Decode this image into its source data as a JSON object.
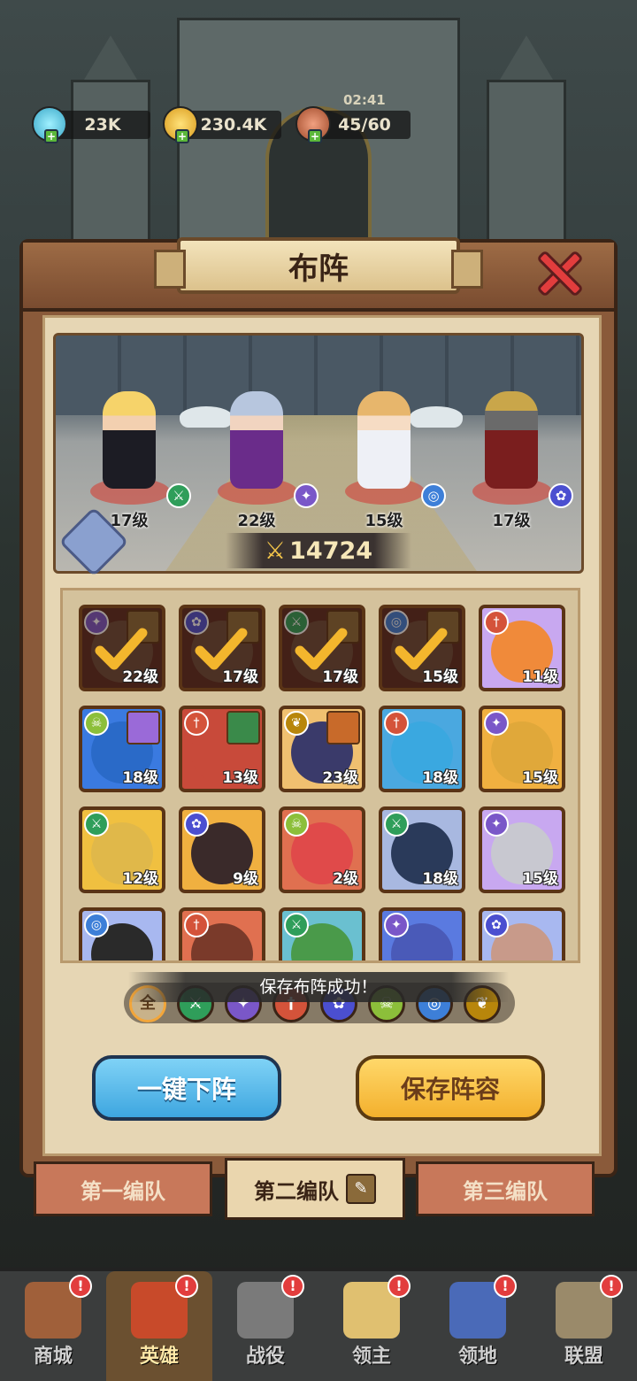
{
  "resources": {
    "gems": "23K",
    "gold": "230.4K",
    "stamina": "45/60",
    "timer": "02:41"
  },
  "panel": {
    "title": "布阵"
  },
  "stage": {
    "heroes": [
      {
        "level": "17级",
        "class_icon": "bow-icon",
        "color": "#2f9e5a"
      },
      {
        "level": "22级",
        "class_icon": "staff-icon",
        "color": "#7a57c8"
      },
      {
        "level": "15级",
        "class_icon": "swirl-icon",
        "color": "#3d7fd8"
      },
      {
        "level": "17级",
        "class_icon": "paw-icon",
        "color": "#4b4fd0"
      }
    ],
    "power": "14724"
  },
  "hero_cards": [
    {
      "level": "22级",
      "selected": true,
      "class_icon": "staff-icon",
      "class_color": "#7a57c8"
    },
    {
      "level": "17级",
      "selected": true,
      "class_icon": "paw-icon",
      "class_color": "#4b4fd0"
    },
    {
      "level": "17级",
      "selected": true,
      "class_icon": "bow-icon",
      "class_color": "#2f9e5a"
    },
    {
      "level": "15级",
      "selected": true,
      "class_icon": "swirl-icon",
      "class_color": "#3d7fd8"
    },
    {
      "level": "11级",
      "selected": false,
      "class_icon": "sword-icon",
      "class_color": "#d4533a"
    },
    {
      "level": "18级",
      "selected": false,
      "class_icon": "skull-icon",
      "class_color": "#8cbf3a"
    },
    {
      "level": "13级",
      "selected": false,
      "class_icon": "sword-icon",
      "class_color": "#d4533a"
    },
    {
      "level": "23级",
      "selected": false,
      "class_icon": "wing-icon",
      "class_color": "#b8860b"
    },
    {
      "level": "18级",
      "selected": false,
      "class_icon": "sword-icon",
      "class_color": "#d4533a"
    },
    {
      "level": "15级",
      "selected": false,
      "class_icon": "staff-icon",
      "class_color": "#7a57c8"
    },
    {
      "level": "12级",
      "selected": false,
      "class_icon": "bow-icon",
      "class_color": "#2f9e5a"
    },
    {
      "level": "9级",
      "selected": false,
      "class_icon": "paw-icon",
      "class_color": "#4b4fd0"
    },
    {
      "level": "2级",
      "selected": false,
      "class_icon": "skull-icon",
      "class_color": "#8cbf3a"
    },
    {
      "level": "18级",
      "selected": false,
      "class_icon": "bow-icon",
      "class_color": "#2f9e5a"
    },
    {
      "level": "15级",
      "selected": false,
      "class_icon": "staff-icon",
      "class_color": "#7a57c8"
    },
    {
      "level": "",
      "selected": false,
      "class_icon": "swirl-icon",
      "class_color": "#3d7fd8"
    },
    {
      "level": "",
      "selected": false,
      "class_icon": "sword-icon",
      "class_color": "#d4533a"
    },
    {
      "level": "",
      "selected": false,
      "class_icon": "bow-icon",
      "class_color": "#2f9e5a"
    },
    {
      "level": "",
      "selected": false,
      "class_icon": "staff-icon",
      "class_color": "#7a57c8"
    },
    {
      "level": "",
      "selected": false,
      "class_icon": "paw-icon",
      "class_color": "#4b4fd0"
    }
  ],
  "toast": "保存布阵成功！",
  "filters": [
    {
      "label": "全",
      "name": "all"
    },
    {
      "label": "",
      "name": "bow",
      "color": "#2f9e5a"
    },
    {
      "label": "",
      "name": "staff",
      "color": "#7a57c8"
    },
    {
      "label": "",
      "name": "sword",
      "color": "#d4533a"
    },
    {
      "label": "",
      "name": "paw",
      "color": "#4b4fd0"
    },
    {
      "label": "",
      "name": "skull",
      "color": "#8cbf3a"
    },
    {
      "label": "",
      "name": "swirl",
      "color": "#3d7fd8"
    },
    {
      "label": "",
      "name": "wing",
      "color": "#b8860b"
    }
  ],
  "buttons": {
    "unequip_all": "一键下阵",
    "save_lineup": "保存阵容"
  },
  "teams": {
    "team1": "第一编队",
    "team2": "第二编队",
    "team3": "第三编队"
  },
  "nav": [
    {
      "label": "商城",
      "icon": "shop-icon"
    },
    {
      "label": "英雄",
      "icon": "hero-card-icon",
      "active": true
    },
    {
      "label": "战役",
      "icon": "battle-icon"
    },
    {
      "label": "领主",
      "icon": "lord-icon"
    },
    {
      "label": "领地",
      "icon": "territory-icon"
    },
    {
      "label": "联盟",
      "icon": "alliance-icon"
    }
  ]
}
